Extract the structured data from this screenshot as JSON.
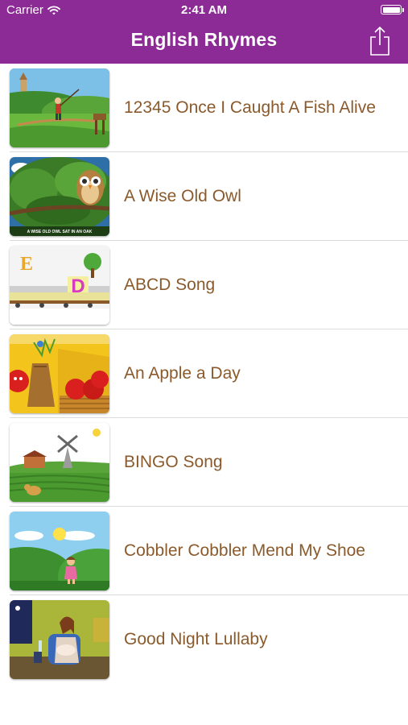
{
  "status_bar": {
    "carrier": "Carrier",
    "time": "2:41 AM"
  },
  "nav": {
    "title": "English Rhymes",
    "share_icon": "share-icon"
  },
  "colors": {
    "header": "#8c2a96",
    "row_text": "#8a5a2c",
    "separator": "#dcdcdc"
  },
  "rhymes": [
    {
      "title": "12345 Once I Caught A Fish Alive",
      "thumbnail": "boy-fishing-thumbnail"
    },
    {
      "title": "A Wise Old Owl",
      "thumbnail": "owl-in-tree-thumbnail",
      "caption": "A WISE OLD OWL SAT IN AN OAK"
    },
    {
      "title": "ABCD Song",
      "thumbnail": "alphabet-train-thumbnail",
      "letters": [
        "E",
        "D"
      ]
    },
    {
      "title": "An Apple a Day",
      "thumbnail": "apples-basket-thumbnail"
    },
    {
      "title": "BINGO Song",
      "thumbnail": "farm-windmill-thumbnail"
    },
    {
      "title": "Cobbler Cobbler Mend My Shoe",
      "thumbnail": "girl-in-meadow-thumbnail"
    },
    {
      "title": "Good Night Lullaby",
      "thumbnail": "mother-lullaby-thumbnail"
    }
  ]
}
